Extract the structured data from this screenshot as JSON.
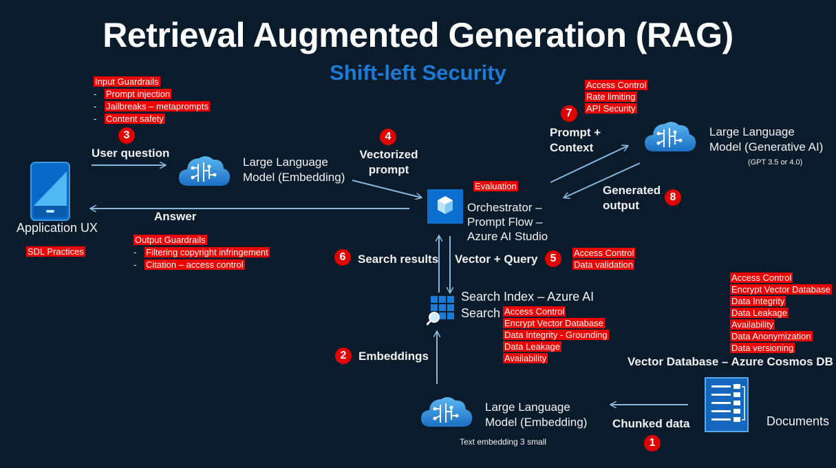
{
  "title": "Retrieval Augmented Generation (RAG)",
  "subtitle": "Shift-left Security",
  "nodes": {
    "app": {
      "label": "Application UX"
    },
    "llm_embed_top": {
      "label_line1": "Large Language",
      "label_line2": "Model (Embedding)"
    },
    "llm_gen": {
      "label_line1": "Large Language",
      "label_line2": "Model (Generative AI)",
      "note": "(GPT 3.5 or 4.0)"
    },
    "orchestrator": {
      "label_line1": "Orchestrator –",
      "label_line2": "Prompt Flow –",
      "label_line3": "Azure AI Studio"
    },
    "search": {
      "label_line1": "Search Index – Azure AI",
      "label_line2": "Search"
    },
    "vector_db": {
      "label": "Vector Database – Azure Cosmos DB"
    },
    "llm_embed_bottom": {
      "label_line1": "Large Language",
      "label_line2": "Model (Embedding)",
      "note": "Text embedding 3 small"
    },
    "documents": {
      "label": "Documents"
    }
  },
  "steps": {
    "s1": {
      "num": "1",
      "label": "Chunked data"
    },
    "s2": {
      "num": "2",
      "label": "Embeddings"
    },
    "s3": {
      "num": "3",
      "label": "User question"
    },
    "s4": {
      "num": "4",
      "label_line1": "Vectorized",
      "label_line2": "prompt"
    },
    "s5": {
      "num": "5",
      "label": "Vector + Query"
    },
    "s6": {
      "num": "6",
      "label": "Search results"
    },
    "s7": {
      "num": "7",
      "label_line1": "Prompt +",
      "label_line2": "Context"
    },
    "s8": {
      "num": "8",
      "label_line1": "Generated",
      "label_line2": "output"
    },
    "answer": {
      "label": "Answer"
    }
  },
  "security": {
    "input_guardrails": {
      "title": "Input Guardrails",
      "items": [
        "Prompt injection",
        "Jailbreaks – metaprompts",
        "Content safety"
      ]
    },
    "output_guardrails": {
      "title": "Output Guardrails",
      "items": [
        "Filtering copyright infringement",
        "Citation – access control"
      ]
    },
    "sdl": "SDL Practices",
    "evaluation": "Evaluation",
    "llm_gen": [
      "Access Control",
      "Rate limiting",
      "API Security"
    ],
    "vector_query": [
      "Access Control",
      "Data validation"
    ],
    "search": [
      "Access Control",
      "Encrypt Vector Database",
      "Data Integrity - Grounding",
      "Data Leakage",
      "Availability"
    ],
    "vector_db": [
      "Access Control",
      "Encrypt Vector Database",
      "Data Integrity",
      "Data Leakage",
      "Availability",
      "Data Anonymization",
      "Data versioning"
    ]
  },
  "colors": {
    "background": "#0a1b2c",
    "accent": "#1c7cd5",
    "security_box": "#ee0000",
    "arrow": "#8ab8dc"
  }
}
